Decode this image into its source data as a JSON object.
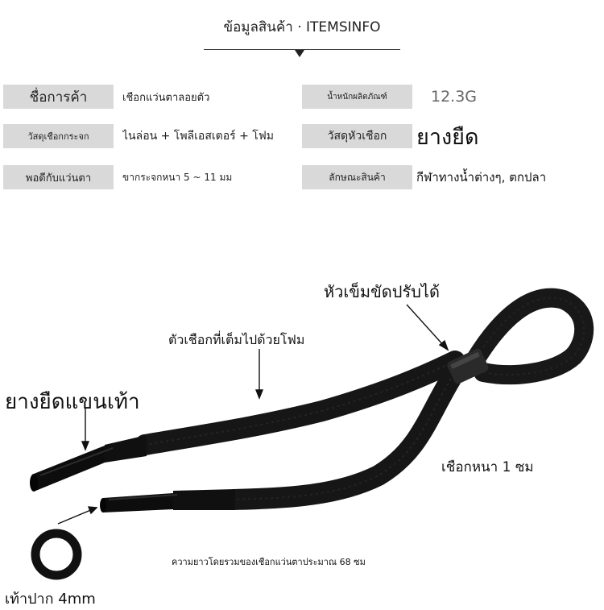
{
  "header": {
    "title": "ข้อมูลสินค้า · ITEMSINFO"
  },
  "specs": [
    {
      "label": "ชื่อการค้า",
      "value": "เชือกแว่นตาลอยตัว"
    },
    {
      "label": "น้ำหนักผลิตภัณฑ์",
      "value": "12.3G"
    },
    {
      "label": "วัสดุเชือกกระจก",
      "value": "ไนล่อน + โพลีเอสเตอร์ + โฟม"
    },
    {
      "label": "วัสดุหัวเชือก",
      "value": "ยางยืด"
    },
    {
      "label": "พอดีกับแว่นตา",
      "value": "ขากระจกหนา 5 ~ 11 มม"
    },
    {
      "label": "ลักษณะสินค้า",
      "value": "กีฬาทางน้ำต่างๆ, ตกปลา"
    }
  ],
  "annotations": {
    "buckle": "หัวเข็มขัดปรับได้",
    "foam": "ตัวเชือกที่เต็มไปด้วยโฟม",
    "rubber_tip": "ยางยืดแขนเท้า",
    "thickness": "เชือกหนา 1 ซม",
    "length": "ความยาวโดยรวมของเชือกแว่นตาประมาณ 68 ซม",
    "mouth": "เท้าปาก 4mm"
  },
  "colors": {
    "label_bg": "#d9d9d9",
    "cord": "#161616"
  }
}
